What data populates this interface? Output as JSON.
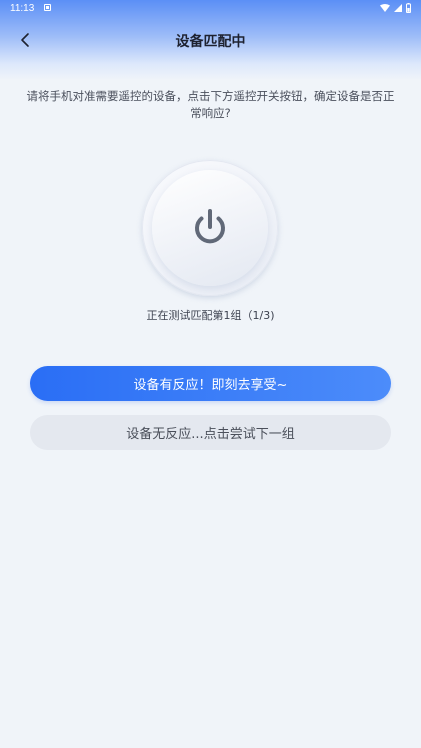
{
  "status_bar": {
    "time": "11:13"
  },
  "header": {
    "title": "设备匹配中"
  },
  "instruction": "请将手机对准需要遥控的设备，点击下方遥控开关按钮，确定设备是否正常响应?",
  "progress": {
    "text": "正在测试匹配第1组（1/3)"
  },
  "buttons": {
    "respond_label": "设备有反应！即刻去享受~",
    "no_respond_label": "设备无反应...点击尝试下一组"
  },
  "icons": {
    "back": "chevron-left-icon",
    "power": "power-icon",
    "wifi": "wifi-icon",
    "signal": "signal-icon",
    "battery": "battery-icon",
    "notification": "notification-icon"
  },
  "colors": {
    "header_gradient_top": "#5b8ff6",
    "background": "#f0f4f9",
    "primary_button": "#2a6ef5",
    "secondary_button": "#e4e8ef",
    "power_icon": "#616978"
  }
}
